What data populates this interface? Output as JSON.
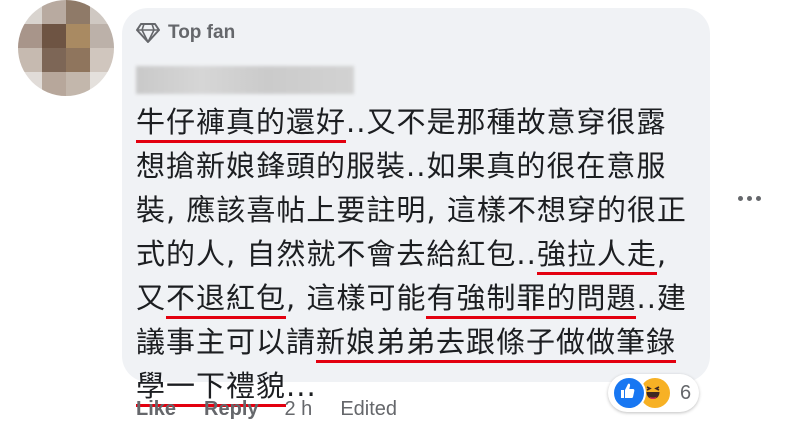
{
  "comment": {
    "badge_label": "Top fan",
    "lines": [
      [
        {
          "t": "牛仔褲真的還好",
          "hl": true
        },
        {
          "t": "..又不是那種故意穿很露",
          "hl": false
        }
      ],
      [
        {
          "t": "想搶新娘鋒頭的服裝..如果真的很在意服",
          "hl": false
        }
      ],
      [
        {
          "t": "裝, 應該喜帖上要註明, 這樣不想穿的很正",
          "hl": false
        }
      ],
      [
        {
          "t": "式的人, 自然就不會去給紅包..",
          "hl": false
        },
        {
          "t": "強拉人走",
          "hl": true
        },
        {
          "t": ",",
          "hl": false
        }
      ],
      [
        {
          "t": "又",
          "hl": false
        },
        {
          "t": "不退紅包",
          "hl": true
        },
        {
          "t": ", 這樣可能",
          "hl": false
        },
        {
          "t": "有強制罪的問題",
          "hl": true
        },
        {
          "t": "..建",
          "hl": false
        }
      ],
      [
        {
          "t": "議事主可以請",
          "hl": false
        },
        {
          "t": "新娘弟弟去跟條子做做筆錄",
          "hl": true
        }
      ],
      [
        {
          "t": "學一下禮貌",
          "hl": true
        },
        {
          "t": "...",
          "hl": false
        }
      ]
    ],
    "reaction_count": "6",
    "reaction_icons": [
      "like-icon",
      "haha-icon"
    ]
  },
  "actions": {
    "like_label": "Like",
    "reply_label": "Reply",
    "time": "2 h",
    "edited": "Edited"
  },
  "colors": {
    "bubble": "#f0f2f5",
    "text": "#1c1e21",
    "secondary": "#65676b",
    "underline": "#e3000f",
    "like_blue": "#1877f2",
    "haha_yellow": "#f7b125"
  }
}
